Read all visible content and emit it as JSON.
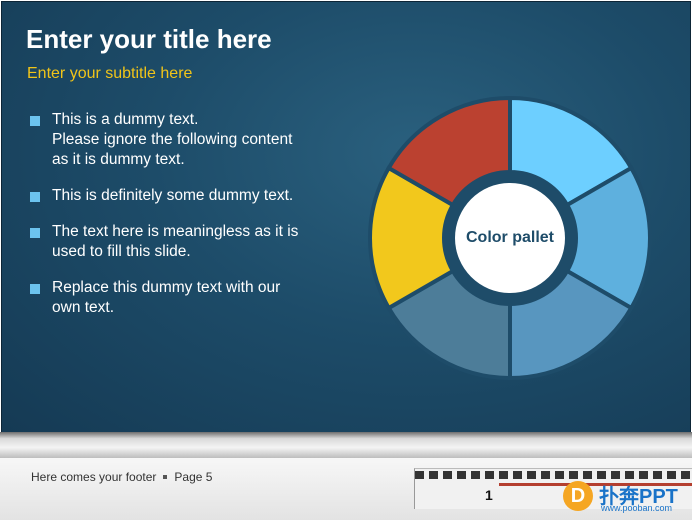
{
  "slide": {
    "title": "Enter your title here",
    "subtitle": "Enter your subtitle here",
    "bullets": [
      {
        "lines": [
          "This is a dummy text.",
          "Please ignore the following content",
          "as it is dummy text."
        ]
      },
      {
        "lines": [
          "This is definitely some dummy text."
        ]
      },
      {
        "lines": [
          "The text here is meaningless as it is",
          "used to fill this slide."
        ]
      },
      {
        "lines": [
          "Replace this dummy text with our",
          "own text."
        ]
      }
    ],
    "colors": {
      "accent_title": "#f0c419",
      "bullet_marker": "#6cc3ee",
      "board": "#1d4c69"
    }
  },
  "chart_data": {
    "type": "pie",
    "center_label": "Color pallet",
    "segments": [
      {
        "color": "#6dcfff",
        "value": 1
      },
      {
        "color": "#5eb0de",
        "value": 1
      },
      {
        "color": "#5896bf",
        "value": 1
      },
      {
        "color": "#4d7d99",
        "value": 1
      },
      {
        "color": "#f2c81c",
        "value": 1
      },
      {
        "color": "#bb4130",
        "value": 1
      }
    ]
  },
  "footer": {
    "text": "Here comes your footer",
    "page": "Page 5",
    "ruler_number": "1"
  },
  "watermark": {
    "logo_icon": "logo-letter-icon",
    "logo_letter": "D",
    "brand_text": "扑奔PPT",
    "url_text": "www.pooban.com"
  }
}
